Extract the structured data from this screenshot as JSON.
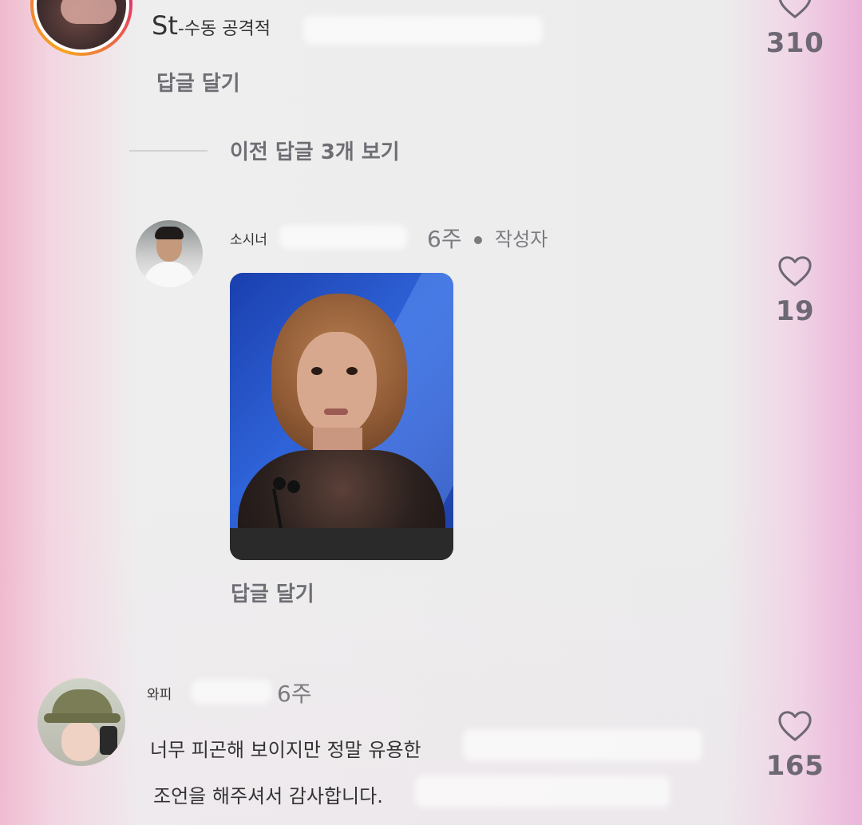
{
  "comment_1": {
    "username": "St",
    "username_suffix": "-수동 공격적",
    "reply_label": "답글 달기",
    "like_count": "310"
  },
  "replies": {
    "view_previous_label": "이전 답글 3개 보기"
  },
  "reply_author": {
    "username": "소시너",
    "time": "6주",
    "author_badge": "작성자",
    "reply_label": "답글 달기",
    "like_count": "19"
  },
  "comment_2": {
    "username": "와피",
    "time": "6주",
    "text_line_1": "너무 피곤해 보이지만 정말 유용한",
    "text_line_2": "조언을 해주셔서 감사합니다.",
    "like_count": "165"
  },
  "icons": {
    "like": "heart-icon"
  },
  "colors": {
    "background": "#ececec",
    "muted_text": "#6e6e75",
    "like_count": "#6e6875",
    "story_ring": "#f06a3a"
  }
}
